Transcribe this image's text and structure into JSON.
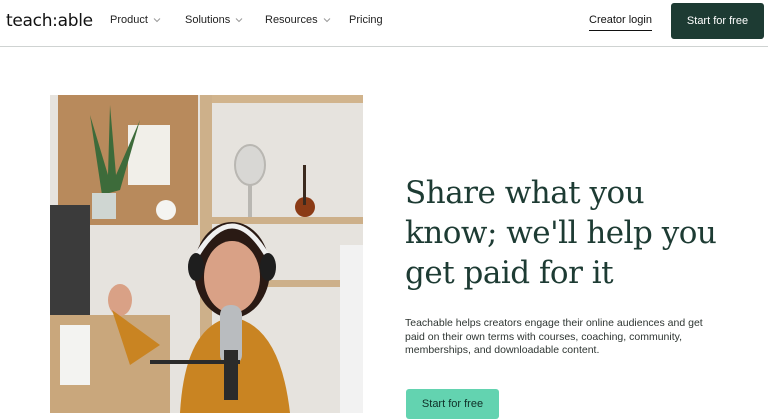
{
  "nav": {
    "logo": "teach:able",
    "items": [
      {
        "label": "Product",
        "has_dropdown": true
      },
      {
        "label": "Solutions",
        "has_dropdown": true
      },
      {
        "label": "Resources",
        "has_dropdown": true
      },
      {
        "label": "Pricing",
        "has_dropdown": false
      }
    ],
    "login_label": "Creator login",
    "cta_label": "Start for free"
  },
  "hero": {
    "headline_lines": [
      "Share what you",
      "know; we'll help you",
      "get paid for it"
    ],
    "subtext": "Teachable helps creators engage their online audiences and get paid on their own terms with courses, coaching, community, memberships, and downloadable content.",
    "cta_label": "Start for free",
    "image_icon": "photo-podcast-creator"
  },
  "colors": {
    "brand_dark": "#1d3b33",
    "accent": "#63d3b0"
  }
}
